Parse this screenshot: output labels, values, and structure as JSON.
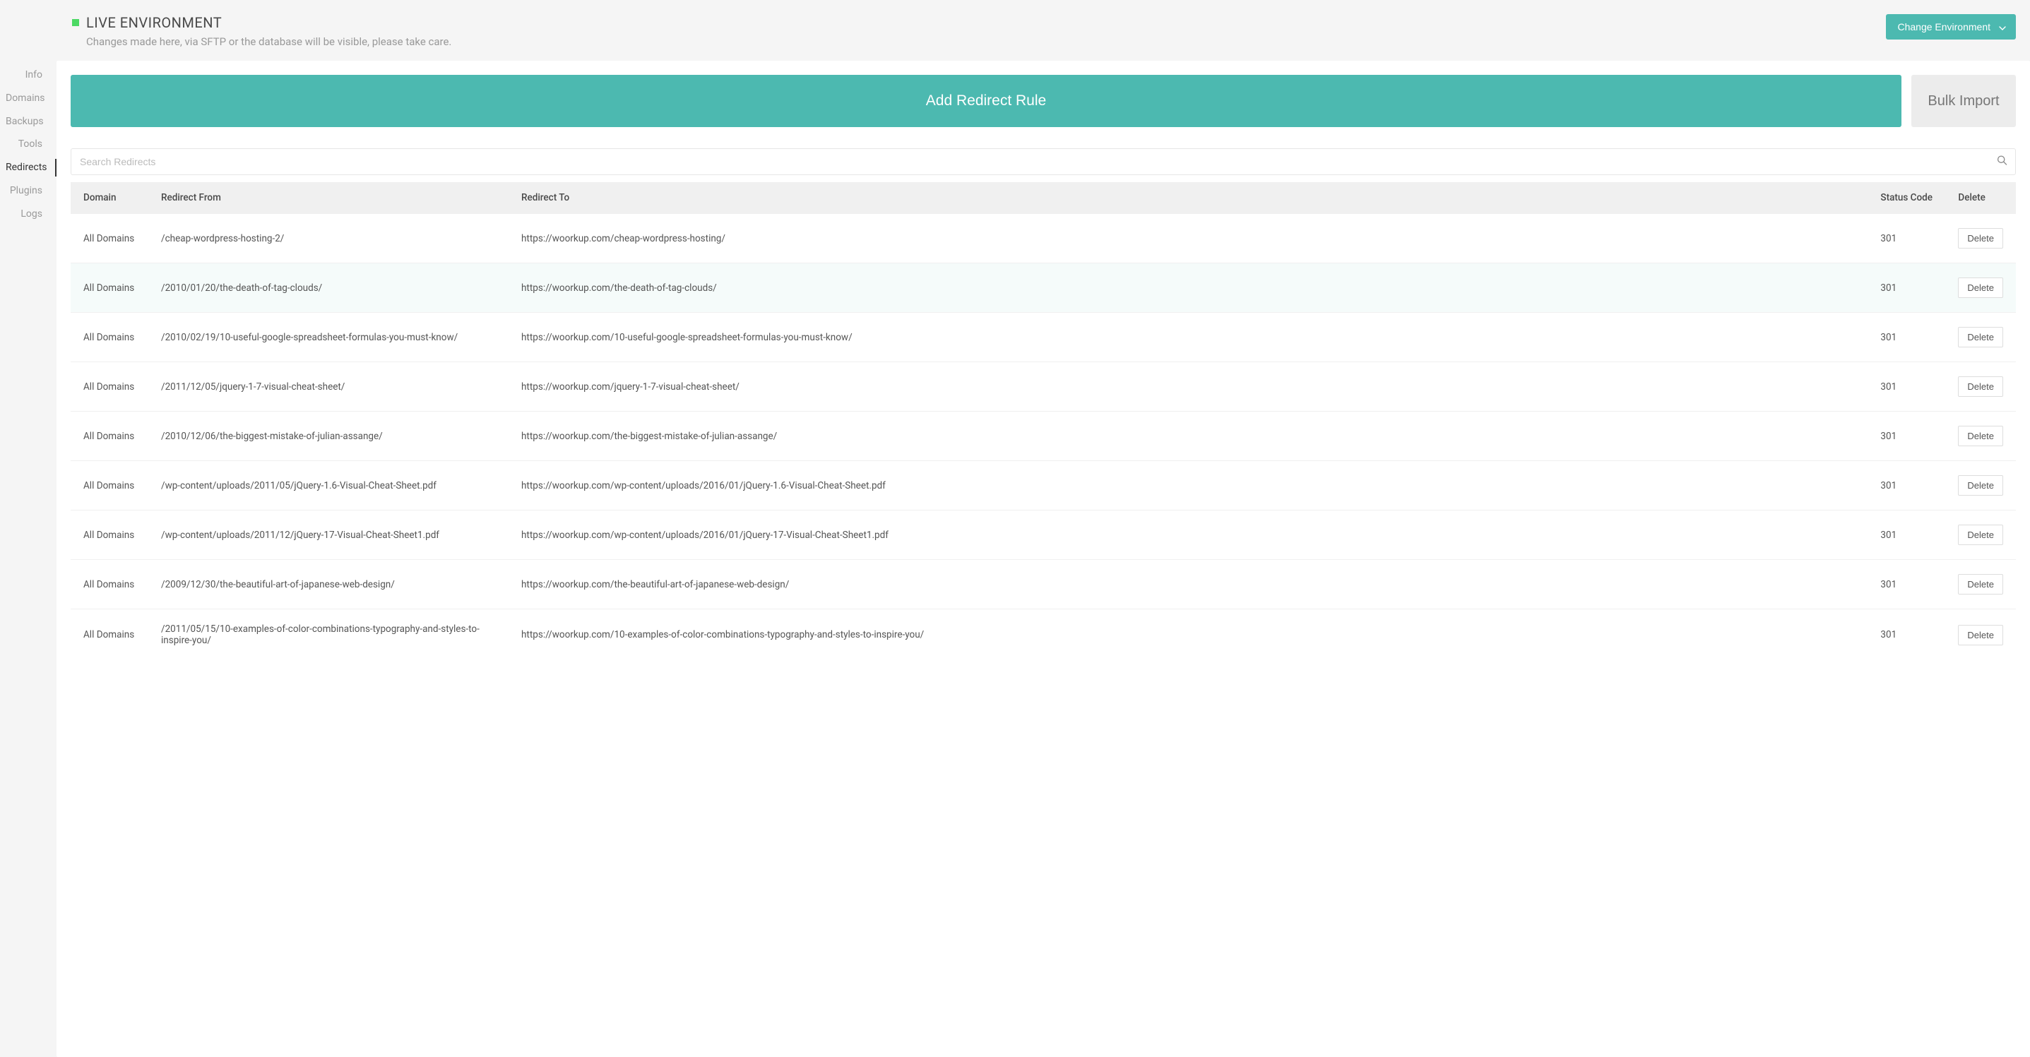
{
  "sidebar": {
    "items": [
      {
        "label": "Info"
      },
      {
        "label": "Domains"
      },
      {
        "label": "Backups"
      },
      {
        "label": "Tools"
      },
      {
        "label": "Redirects"
      },
      {
        "label": "Plugins"
      },
      {
        "label": "Logs"
      }
    ]
  },
  "header": {
    "env_title": "LIVE ENVIRONMENT",
    "env_subtext": "Changes made here, via SFTP or the database will be visible, please take care.",
    "change_env_label": "Change Environment"
  },
  "actions": {
    "add_rule_label": "Add Redirect Rule",
    "bulk_import_label": "Bulk Import"
  },
  "search": {
    "placeholder": "Search Redirects"
  },
  "table": {
    "headers": {
      "domain": "Domain",
      "from": "Redirect From",
      "to": "Redirect To",
      "status": "Status Code",
      "delete": "Delete"
    },
    "delete_label": "Delete",
    "rows": [
      {
        "domain": "All Domains",
        "from": "/cheap-wordpress-hosting-2/",
        "to": "https://woorkup.com/cheap-wordpress-hosting/",
        "status": "301"
      },
      {
        "domain": "All Domains",
        "from": "/2010/01/20/the-death-of-tag-clouds/",
        "to": "https://woorkup.com/the-death-of-tag-clouds/",
        "status": "301"
      },
      {
        "domain": "All Domains",
        "from": "/2010/02/19/10-useful-google-spreadsheet-formulas-you-must-know/",
        "to": "https://woorkup.com/10-useful-google-spreadsheet-formulas-you-must-know/",
        "status": "301"
      },
      {
        "domain": "All Domains",
        "from": "/2011/12/05/jquery-1-7-visual-cheat-sheet/",
        "to": "https://woorkup.com/jquery-1-7-visual-cheat-sheet/",
        "status": "301"
      },
      {
        "domain": "All Domains",
        "from": "/2010/12/06/the-biggest-mistake-of-julian-assange/",
        "to": "https://woorkup.com/the-biggest-mistake-of-julian-assange/",
        "status": "301"
      },
      {
        "domain": "All Domains",
        "from": "/wp-content/uploads/2011/05/jQuery-1.6-Visual-Cheat-Sheet.pdf",
        "to": "https://woorkup.com/wp-content/uploads/2016/01/jQuery-1.6-Visual-Cheat-Sheet.pdf",
        "status": "301"
      },
      {
        "domain": "All Domains",
        "from": "/wp-content/uploads/2011/12/jQuery-17-Visual-Cheat-Sheet1.pdf",
        "to": "https://woorkup.com/wp-content/uploads/2016/01/jQuery-17-Visual-Cheat-Sheet1.pdf",
        "status": "301"
      },
      {
        "domain": "All Domains",
        "from": "/2009/12/30/the-beautiful-art-of-japanese-web-design/",
        "to": "https://woorkup.com/the-beautiful-art-of-japanese-web-design/",
        "status": "301"
      },
      {
        "domain": "All Domains",
        "from": "/2011/05/15/10-examples-of-color-combinations-typography-and-styles-to-inspire-you/",
        "to": "https://woorkup.com/10-examples-of-color-combinations-typography-and-styles-to-inspire-you/",
        "status": "301"
      }
    ]
  }
}
